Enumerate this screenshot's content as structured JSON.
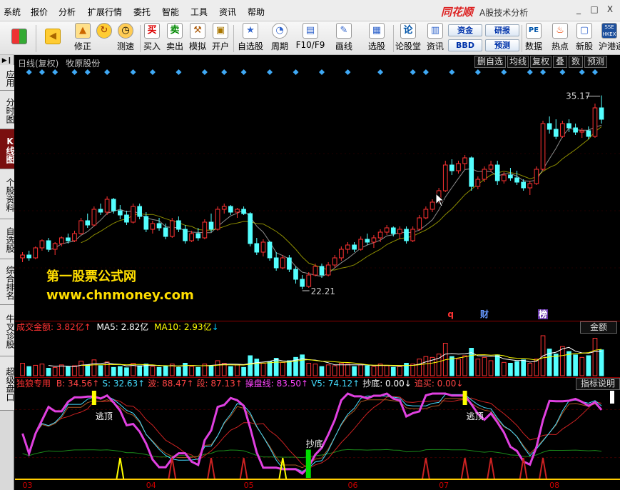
{
  "menu": [
    "系统",
    "报价",
    "分析",
    "扩展行情",
    "委托",
    "智能",
    "工具",
    "资讯",
    "帮助"
  ],
  "brand": "同花顺",
  "app_title": "A股技术分析",
  "window_controls": [
    "_",
    "□",
    "X"
  ],
  "toolbar": {
    "buttons": [
      {
        "label": "",
        "icon": "windows-logo-icon"
      },
      {
        "label": "",
        "icon": "back-arrow-icon"
      },
      {
        "label": "修正",
        "icon": "up-arrow-icon"
      },
      {
        "label": "测速",
        "icon": "clock-icon"
      },
      {
        "label": "买入",
        "icon": "buy-icon",
        "glyph": "买"
      },
      {
        "label": "卖出",
        "icon": "sell-icon",
        "glyph": "卖"
      },
      {
        "label": "模拟",
        "icon": "hammer-icon"
      },
      {
        "label": "开户",
        "icon": "lock-icon"
      },
      {
        "label": "自选股",
        "icon": "star-icon"
      },
      {
        "label": "周期",
        "icon": "period-icon"
      },
      {
        "label": "F10/F9",
        "icon": "f10-icon"
      },
      {
        "label": "画线",
        "icon": "pen-icon"
      },
      {
        "label": "选股",
        "icon": "screen-icon"
      },
      {
        "label": "论股堂",
        "icon": "forum-icon",
        "glyph": "论"
      },
      {
        "label": "资讯",
        "icon": "news-icon"
      },
      {
        "label": "数据",
        "icon": "pe-icon",
        "glyph": "PE"
      },
      {
        "label": "热点",
        "icon": "fire-icon"
      },
      {
        "label": "新股",
        "icon": "newstock-icon"
      },
      {
        "label": "沪港通",
        "icon": "sse-hkex-icon"
      }
    ],
    "pills": [
      "资金",
      "研报",
      "BBD",
      "预测"
    ]
  },
  "sidebar": {
    "tabs": [
      "应用",
      "分时图",
      "K线图",
      "个股资料",
      "自选股",
      "综合排名",
      "牛叉诊股",
      "超级盘口"
    ],
    "active": "K线图"
  },
  "chart_header": {
    "period": "日线(复权)",
    "stock_name": "牧原股份",
    "buttons": [
      "删自选",
      "均线",
      "复权",
      "叠",
      "数",
      "预测"
    ]
  },
  "price_labels": {
    "high": "35.17",
    "low": "22.21"
  },
  "event_markers": [
    {
      "text": "q",
      "color": "#ff3333"
    },
    {
      "text": "财",
      "color": "#6699ff"
    },
    {
      "text": "榜",
      "color": "#cc66ff"
    }
  ],
  "volume": {
    "name": "成交金额:",
    "value": "3.82亿",
    "arrow": "↑",
    "ma5_label": "MA5:",
    "ma5": "2.82亿",
    "ma10_label": "MA10:",
    "ma10": "2.93亿",
    "ma10_arrow": "↓",
    "tag": "金额"
  },
  "indicator": {
    "name": "独狼专用",
    "items": [
      {
        "label": "B:",
        "value": "34.56",
        "arrow": "↑",
        "color": "#ff4444"
      },
      {
        "label": "S:",
        "value": "32.63",
        "arrow": "↑",
        "color": "#44ddff"
      },
      {
        "label": "波:",
        "value": "88.47",
        "arrow": "↑",
        "color": "#ff4444"
      },
      {
        "label": "段:",
        "value": "87.13",
        "arrow": "↑",
        "color": "#ff4444"
      },
      {
        "label": "操盘线:",
        "value": "83.50",
        "arrow": "↑",
        "color": "#ff44ff"
      },
      {
        "label": "V5:",
        "value": "74.12",
        "arrow": "↑",
        "color": "#44ddff"
      },
      {
        "label": "抄底:",
        "value": "0.00",
        "arrow": "↓",
        "color": "#ffffff"
      },
      {
        "label": "追买:",
        "value": "0.00",
        "arrow": "↓",
        "color": "#ff4444"
      }
    ],
    "tag": "指标说明",
    "annotations": [
      "逃顶",
      "抄底",
      "逃顶"
    ]
  },
  "watermark": {
    "line1": "第一股票公式网",
    "line2": "www.chnmoney.com"
  },
  "x_axis": [
    "03",
    "04",
    "05",
    "06",
    "07",
    "08"
  ],
  "colors": {
    "up": "#ff3232",
    "down": "#54ffff",
    "ma5": "#ffffff",
    "ma10": "#ffff00",
    "frame": "#8b0000"
  },
  "candles": [
    [
      23.8,
      24.2,
      23.5,
      24.0
    ],
    [
      24.0,
      24.3,
      23.6,
      23.8
    ],
    [
      23.8,
      24.6,
      23.7,
      24.5
    ],
    [
      24.5,
      25.1,
      24.3,
      25.0
    ],
    [
      25.0,
      25.2,
      24.2,
      24.4
    ],
    [
      24.4,
      24.9,
      24.0,
      24.8
    ],
    [
      24.8,
      25.3,
      24.6,
      25.2
    ],
    [
      25.2,
      25.5,
      24.8,
      25.0
    ],
    [
      25.0,
      25.7,
      24.9,
      25.5
    ],
    [
      25.5,
      26.6,
      25.4,
      26.4
    ],
    [
      26.4,
      26.9,
      25.9,
      26.1
    ],
    [
      26.1,
      27.4,
      26.0,
      27.2
    ],
    [
      27.2,
      27.6,
      26.8,
      27.0
    ],
    [
      27.0,
      28.1,
      26.8,
      27.9
    ],
    [
      27.9,
      28.0,
      26.9,
      27.1
    ],
    [
      27.1,
      27.5,
      26.5,
      26.8
    ],
    [
      26.8,
      27.1,
      26.1,
      26.3
    ],
    [
      26.3,
      27.6,
      26.2,
      27.4
    ],
    [
      27.4,
      27.6,
      26.5,
      26.7
    ],
    [
      26.7,
      27.0,
      25.6,
      25.8
    ],
    [
      25.8,
      26.4,
      25.5,
      26.2
    ],
    [
      26.2,
      26.6,
      25.7,
      25.9
    ],
    [
      25.9,
      26.2,
      25.1,
      25.3
    ],
    [
      25.3,
      26.6,
      25.2,
      26.4
    ],
    [
      26.4,
      26.7,
      25.6,
      25.8
    ],
    [
      25.8,
      26.1,
      24.8,
      25.0
    ],
    [
      25.0,
      25.7,
      24.9,
      25.5
    ],
    [
      25.5,
      25.9,
      25.0,
      25.2
    ],
    [
      25.2,
      26.5,
      25.1,
      26.3
    ],
    [
      26.3,
      26.9,
      25.6,
      25.8
    ],
    [
      25.8,
      27.4,
      25.7,
      27.2
    ],
    [
      27.2,
      27.6,
      26.9,
      27.4
    ],
    [
      27.4,
      27.5,
      26.8,
      27.0
    ],
    [
      27.0,
      27.3,
      26.6,
      27.2
    ],
    [
      27.2,
      27.4,
      26.8,
      26.9
    ],
    [
      26.9,
      27.0,
      24.6,
      24.8
    ],
    [
      24.8,
      25.2,
      24.0,
      24.2
    ],
    [
      24.2,
      25.1,
      23.9,
      24.9
    ],
    [
      24.9,
      25.0,
      23.6,
      23.8
    ],
    [
      23.8,
      24.2,
      22.9,
      23.1
    ],
    [
      23.1,
      24.0,
      23.0,
      23.8
    ],
    [
      23.8,
      24.0,
      22.8,
      23.0
    ],
    [
      23.0,
      23.2,
      22.0,
      22.3
    ],
    [
      22.3,
      22.6,
      21.6,
      21.8
    ],
    [
      21.8,
      22.8,
      21.7,
      22.6
    ],
    [
      22.6,
      23.4,
      22.5,
      23.2
    ],
    [
      23.2,
      23.4,
      22.4,
      22.6
    ],
    [
      22.6,
      23.5,
      22.5,
      23.3
    ],
    [
      23.3,
      24.0,
      23.1,
      23.8
    ],
    [
      23.8,
      24.6,
      23.6,
      24.4
    ],
    [
      24.4,
      24.9,
      24.1,
      24.7
    ],
    [
      24.7,
      24.9,
      24.2,
      24.4
    ],
    [
      24.4,
      25.3,
      24.3,
      25.1
    ],
    [
      25.1,
      25.5,
      24.7,
      24.9
    ],
    [
      24.9,
      25.4,
      24.5,
      25.2
    ],
    [
      25.2,
      25.8,
      24.9,
      25.6
    ],
    [
      25.6,
      26.1,
      25.4,
      25.9
    ],
    [
      25.9,
      26.0,
      25.3,
      25.5
    ],
    [
      25.5,
      26.0,
      25.1,
      25.8
    ],
    [
      25.8,
      26.0,
      24.8,
      25.0
    ],
    [
      25.0,
      26.0,
      24.9,
      25.8
    ],
    [
      25.8,
      26.8,
      25.7,
      26.6
    ],
    [
      26.6,
      27.4,
      26.5,
      27.2
    ],
    [
      27.2,
      27.9,
      27.0,
      27.7
    ],
    [
      27.7,
      28.7,
      27.6,
      28.5
    ],
    [
      28.5,
      30.6,
      28.4,
      30.3
    ],
    [
      30.3,
      30.7,
      29.6,
      29.9
    ],
    [
      29.9,
      30.6,
      29.7,
      30.4
    ],
    [
      30.4,
      31.0,
      30.0,
      30.8
    ],
    [
      30.8,
      30.9,
      28.5,
      28.8
    ],
    [
      28.8,
      29.5,
      28.6,
      29.3
    ],
    [
      29.3,
      30.2,
      29.1,
      30.0
    ],
    [
      30.0,
      30.6,
      29.8,
      30.3
    ],
    [
      30.3,
      30.6,
      28.9,
      29.2
    ],
    [
      29.2,
      29.8,
      29.0,
      29.6
    ],
    [
      29.6,
      30.1,
      29.2,
      29.4
    ],
    [
      29.4,
      29.9,
      28.9,
      29.1
    ],
    [
      29.1,
      29.3,
      28.5,
      28.7
    ],
    [
      28.7,
      29.2,
      28.2,
      29.0
    ],
    [
      29.0,
      30.2,
      28.9,
      30.0
    ],
    [
      30.0,
      33.4,
      29.9,
      33.2
    ],
    [
      33.2,
      33.7,
      32.5,
      32.8
    ],
    [
      32.8,
      33.5,
      32.1,
      32.3
    ],
    [
      32.3,
      33.4,
      32.2,
      33.2
    ],
    [
      33.2,
      33.5,
      32.6,
      32.9
    ],
    [
      32.9,
      33.2,
      32.4,
      32.6
    ],
    [
      32.6,
      32.9,
      32.2,
      32.7
    ],
    [
      32.7,
      33.0,
      32.1,
      32.3
    ],
    [
      32.3,
      34.6,
      32.2,
      34.3
    ],
    [
      34.3,
      35.17,
      33.2,
      33.5
    ]
  ],
  "volumes": [
    30,
    22,
    25,
    28,
    18,
    20,
    26,
    22,
    24,
    35,
    26,
    38,
    24,
    33,
    20,
    22,
    19,
    30,
    24,
    28,
    22,
    20,
    24,
    28,
    20,
    30,
    22,
    20,
    28,
    24,
    36,
    30,
    22,
    26,
    20,
    48,
    40,
    30,
    34,
    42,
    32,
    36,
    44,
    50,
    30,
    28,
    22,
    26,
    24,
    30,
    28,
    22,
    26,
    24,
    22,
    28,
    24,
    20,
    22,
    30,
    28,
    40,
    46,
    44,
    52,
    78,
    46,
    40,
    48,
    66,
    40,
    44,
    36,
    50,
    32,
    30,
    34,
    38,
    30,
    40,
    96,
    64,
    52,
    70,
    58,
    50,
    44,
    48,
    90,
    62
  ]
}
